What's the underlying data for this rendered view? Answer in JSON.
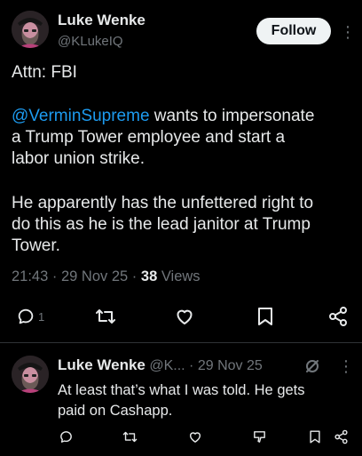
{
  "main_tweet": {
    "author": {
      "display_name": "Luke Wenke",
      "handle": "@KLukeIQ"
    },
    "follow_label": "Follow",
    "more_label": "⋮",
    "text": {
      "line1": "Attn: FBI",
      "mention": "@VerminSupreme",
      "line2_rest": " wants to impersonate",
      "line3": "a Trump Tower employee and start a",
      "line4": "labor union strike.",
      "line5": "He apparently has the unfettered right to",
      "line6": "do this as he is the lead janitor at Trump",
      "line7": "Tower."
    },
    "meta": {
      "time": "21:43",
      "separator": "·",
      "date": "29 Nov 25",
      "views_count": "38",
      "views_label": "Views"
    },
    "actions": {
      "reply_count": "1",
      "reply_icon": "reply-icon",
      "repost_icon": "repost-icon",
      "like_icon": "heart-icon",
      "bookmark_icon": "bookmark-icon",
      "share_icon": "share-icon"
    }
  },
  "reply_tweet": {
    "author": {
      "display_name": "Luke Wenke",
      "handle_truncated": "@K...",
      "separator": "·",
      "date": "29 Nov 25"
    },
    "more_label": "⋮",
    "text": {
      "line1": "At least that’s what I was told.  He gets",
      "line2": "paid on Cashapp."
    },
    "actions": {
      "reply_icon": "reply-icon",
      "repost_icon": "repost-icon",
      "like_icon": "heart-icon",
      "downvote_icon": "downvote-icon",
      "bookmark_icon": "bookmark-icon",
      "share_icon": "share-icon",
      "grok_icon": "grok-slash-icon"
    }
  },
  "colors": {
    "background": "#000000",
    "text_primary": "#e7e9ea",
    "text_secondary": "#71767b",
    "link": "#1d9bf0",
    "divider": "#2f3336",
    "follow_button_bg": "#eff3f4"
  }
}
